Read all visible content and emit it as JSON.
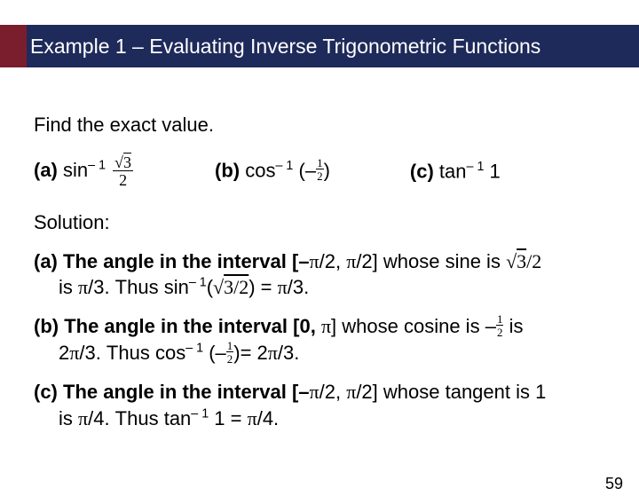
{
  "header": {
    "title": "Example 1 – Evaluating Inverse Trigonometric Functions"
  },
  "prompt": "Find the exact value.",
  "parts": {
    "a": {
      "label": "(a)",
      "func": "sin",
      "exp": "– 1",
      "arg_num": "√3",
      "arg_den": "2"
    },
    "b": {
      "label": "(b)",
      "func": "cos",
      "exp": "– 1",
      "arg_num": "1",
      "arg_den": "2",
      "arg_sign": "–"
    },
    "c": {
      "label": "(c)",
      "func": "tan",
      "exp": "– 1",
      "arg": "1"
    }
  },
  "solution": {
    "heading": "Solution:",
    "a_line1_pre": "(a) The angle in the interval [–",
    "a_line1_mid": "/2, ",
    "a_line1_post": "/2] whose sine is",
    "a_line2_pre": "is ",
    "a_line2_mid": "/3. Thus sin",
    "a_line2_exp": "– 1",
    "a_line2_paren_open": "(",
    "a_line2_paren_close": ") = ",
    "a_line2_end": "/3.",
    "b_line1_pre": "(b) The angle in the interval [0, ",
    "b_line1_post": "] whose cosine is",
    "b_line1_tail": "is",
    "b_line2_pre": "2",
    "b_line2_mid": "/3. Thus cos",
    "b_line2_exp": "– 1",
    "b_line2_eq": "= 2",
    "b_line2_end": "/3.",
    "c_line1_pre": "(c) The angle in the interval [–",
    "c_line1_mid": "/2, ",
    "c_line1_post": "/2] whose tangent is 1",
    "c_line2_pre": "is ",
    "c_line2_mid": "/4. Thus tan",
    "c_line2_exp": "– 1",
    "c_line2_arg": " 1 = ",
    "c_line2_end": "/4."
  },
  "page_number": "59",
  "glyphs": {
    "pi": "π",
    "sqrt3": "√3",
    "sqrt3over2": "√3/2",
    "neg_half_num": "1",
    "neg_half_den": "2"
  }
}
